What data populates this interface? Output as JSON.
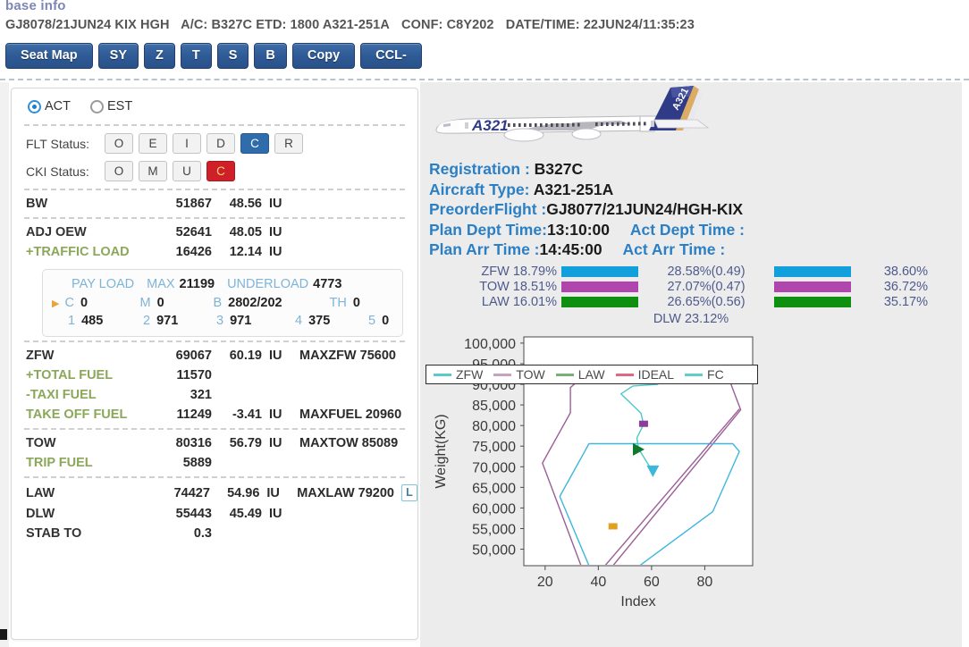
{
  "header": {
    "title": "base info",
    "flight_info": [
      "GJ8078/21JUN24 KIX HGH",
      "A/C: B327C ETD: 1800 A321-251A",
      "CONF: C8Y202",
      "DATE/TIME: 22JUN24/11:35:23"
    ],
    "buttons": [
      {
        "label": "Seat Map",
        "name": "seat-map-button",
        "wide": true
      },
      {
        "label": "SY",
        "name": "sy-button",
        "wide": false
      },
      {
        "label": "Z",
        "name": "z-button",
        "wide": false
      },
      {
        "label": "T",
        "name": "t-button",
        "wide": false
      },
      {
        "label": "S",
        "name": "s-button",
        "wide": false
      },
      {
        "label": "B",
        "name": "b-button",
        "wide": false
      },
      {
        "label": "Copy",
        "name": "copy-button",
        "wide": true
      },
      {
        "label": "CCL-",
        "name": "ccl-button",
        "wide": true
      }
    ]
  },
  "left": {
    "radios": [
      {
        "label": "ACT",
        "selected": true
      },
      {
        "label": "EST",
        "selected": false
      }
    ],
    "flt_status": {
      "label": "FLT Status:",
      "options": [
        "O",
        "E",
        "I",
        "D",
        "C",
        "R"
      ],
      "selected": "C"
    },
    "cki_status": {
      "label": "CKI Status:",
      "options": [
        "O",
        "M",
        "U",
        "C"
      ],
      "selected": "C"
    },
    "bw": {
      "key": "BW",
      "value": "51867",
      "index": "48.56",
      "unit": "IU"
    },
    "adj_oew": {
      "key": "ADJ OEW",
      "value": "52641",
      "index": "48.05",
      "unit": "IU"
    },
    "traffic_load": {
      "key": "+TRAFFIC LOAD",
      "value": "16426",
      "index": "12.14",
      "unit": "IU"
    },
    "payload": {
      "caption": "PAY LOAD",
      "max_label": "MAX",
      "max_value": "21199",
      "underload_label": "UNDERLOAD",
      "underload_value": "4773",
      "cells": [
        {
          "k": "C",
          "v": "0"
        },
        {
          "k": "M",
          "v": "0"
        },
        {
          "k": "B",
          "v": "2802/202"
        },
        {
          "k": "TH",
          "v": "0"
        }
      ],
      "holds": [
        {
          "k": "1",
          "v": "485"
        },
        {
          "k": "2",
          "v": "971"
        },
        {
          "k": "3",
          "v": "971"
        },
        {
          "k": "4",
          "v": "375"
        },
        {
          "k": "5",
          "v": "0"
        }
      ]
    },
    "zfw": {
      "key": "ZFW",
      "value": "69067",
      "index": "60.19",
      "unit": "IU",
      "max_label": "MAXZFW 75600"
    },
    "total_fuel": {
      "key": "+TOTAL FUEL",
      "value": "11570",
      "index": "",
      "unit": "",
      "max_label": ""
    },
    "taxi_fuel": {
      "key": "-TAXI FUEL",
      "value": "321",
      "index": "",
      "unit": "",
      "max_label": ""
    },
    "take_off_fuel": {
      "key": "TAKE OFF FUEL",
      "value": "11249",
      "index": "-3.41",
      "unit": "IU",
      "max_label": "MAXFUEL 20960"
    },
    "tow": {
      "key": "TOW",
      "value": "80316",
      "index": "56.79",
      "unit": "IU",
      "max_label": "MAXTOW 85089"
    },
    "trip_fuel": {
      "key": "TRIP FUEL",
      "value": "5889",
      "index": "",
      "unit": "",
      "max_label": ""
    },
    "law": {
      "key": "LAW",
      "value": "74427",
      "index": "54.96",
      "unit": "IU",
      "max_label": "MAXLAW 79200",
      "badge": "L"
    },
    "dlw": {
      "key": "DLW",
      "value": "55443",
      "index": "45.49",
      "unit": "IU",
      "max_label": ""
    },
    "stab_to": {
      "key": "STAB TO",
      "value": "0.3",
      "index": "",
      "unit": "",
      "max_label": ""
    }
  },
  "right": {
    "aircraft_livery_text": "A321",
    "info": [
      {
        "key": "Registration :",
        "value": "B327C"
      },
      {
        "key": "Aircraft Type:",
        "value": "A321-251A"
      },
      {
        "key": "PreorderFlight :",
        "value": "GJ8077/21JUN24/HGH-KIX"
      },
      {
        "key": "Plan Dept Time:",
        "value": "13:10:00",
        "key2": "Act Dept Time :",
        "value2": ""
      },
      {
        "key": "Plan Arr Time  :",
        "value": "14:45:00",
        "key2": "Act Arr Time   :",
        "value2": ""
      }
    ],
    "percent_rows": [
      {
        "label": "ZFW 18.79%",
        "mid": "28.58%(0.49)",
        "end": "38.60%",
        "color": "#12a0dc"
      },
      {
        "label": "TOW 18.51%",
        "mid": "27.07%(0.47)",
        "end": "36.72%",
        "color": "#b045ae"
      },
      {
        "label": "LAW 16.01%",
        "mid": "26.65%(0.56)",
        "end": "35.17%",
        "color": "#0f8f0f"
      }
    ],
    "dlw_text": "DLW 23.12%"
  },
  "chart_data": {
    "type": "line",
    "title": "",
    "xlabel": "Index",
    "ylabel": "Weight(KG)",
    "xlim": [
      12,
      98
    ],
    "ylim": [
      46000,
      101500
    ],
    "xticks": [
      20,
      40,
      60,
      80
    ],
    "yticks": [
      50000,
      55000,
      60000,
      65000,
      70000,
      75000,
      80000,
      85000,
      90000,
      95000,
      100000
    ],
    "ytick_labels": [
      "50,000",
      "55,000",
      "60,000",
      "65,000",
      "70,000",
      "75,000",
      "80,000",
      "85,000",
      "90,000",
      "95,000",
      "100,000"
    ],
    "grid": false,
    "legend_position": "bottom",
    "legend": [
      {
        "name": "ZFW",
        "color": "#5ec8cf"
      },
      {
        "name": "TOW",
        "color": "#c9a2c0"
      },
      {
        "name": "LAW",
        "color": "#78b07a"
      },
      {
        "name": "IDEAL",
        "color": "#e1667f"
      },
      {
        "name": "FC",
        "color": "#5ed0c6"
      }
    ],
    "series": [
      {
        "name": "TOW envelope",
        "color": "#9b5e96",
        "points": [
          [
            33.5,
            46000
          ],
          [
            19.0,
            70900
          ],
          [
            29.5,
            83100
          ],
          [
            29.5,
            89200
          ],
          [
            36.5,
            93200
          ],
          [
            88.0,
            93200
          ],
          [
            93.5,
            83800
          ],
          [
            45.5,
            46000
          ]
        ]
      },
      {
        "name": "ZFW envelope",
        "color": "#3fb6dd",
        "points": [
          [
            36.5,
            46000
          ],
          [
            25.5,
            62800
          ],
          [
            36.5,
            75600
          ],
          [
            90.5,
            75600
          ],
          [
            93.0,
            73700
          ],
          [
            83.0,
            59100
          ],
          [
            55.5,
            46000
          ]
        ]
      },
      {
        "name": "IDEAL line",
        "color": "#9b5e96",
        "points": [
          [
            42.5,
            46000
          ],
          [
            93.0,
            84000
          ]
        ]
      },
      {
        "name": "FC trace",
        "color": "#4fc6c6",
        "points": [
          [
            60.5,
            68700
          ],
          [
            55.0,
            74500
          ],
          [
            54.5,
            77000
          ],
          [
            57.0,
            80300
          ],
          [
            56.0,
            83000
          ],
          [
            48.5,
            87700
          ],
          [
            53.0,
            89600
          ],
          [
            62.5,
            90000
          ]
        ]
      }
    ],
    "markers": [
      {
        "name": "TOW point",
        "shape": "rect",
        "x": 57.0,
        "y": 80316,
        "color": "#8b3d9b"
      },
      {
        "name": "ZFW point",
        "shape": "triangle-right",
        "x": 55.0,
        "y": 74200,
        "color": "#0f7a2e"
      },
      {
        "name": "LAW point",
        "shape": "triangle-down",
        "x": 60.5,
        "y": 69000,
        "color": "#3fb6dd"
      },
      {
        "name": "DLW point",
        "shape": "rect",
        "x": 45.5,
        "y": 55443,
        "color": "#e0a21e"
      }
    ]
  }
}
